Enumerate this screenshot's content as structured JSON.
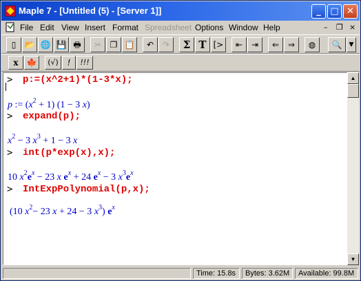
{
  "window": {
    "title": "Maple 7  - [Untitled (5) - [Server 1]]",
    "controls": {
      "minimize": "_",
      "maximize": "□",
      "close": "✕"
    }
  },
  "menu": {
    "items": [
      "File",
      "Edit",
      "View",
      "Insert",
      "Format",
      "Spreadsheet",
      "Options",
      "Window",
      "Help"
    ],
    "disabled": [
      "Spreadsheet"
    ],
    "doc_controls": {
      "minimize": "–",
      "restore": "❐",
      "close": "×"
    }
  },
  "toolbar1": {
    "buttons": [
      {
        "name": "new-icon",
        "glyph": "▯"
      },
      {
        "name": "open-icon",
        "glyph": "📂"
      },
      {
        "name": "open-url-icon",
        "glyph": "🌐"
      },
      {
        "name": "save-icon",
        "glyph": "💾"
      },
      {
        "name": "print-icon",
        "glyph": "🖶"
      },
      {
        "name": "cut-icon",
        "glyph": "✂"
      },
      {
        "name": "copy-icon",
        "glyph": "❐"
      },
      {
        "name": "paste-icon",
        "glyph": "📋"
      },
      {
        "name": "undo-icon",
        "glyph": "↶"
      },
      {
        "name": "redo-icon",
        "glyph": "↷"
      },
      {
        "name": "sigma-icon",
        "glyph": "Σ"
      },
      {
        "name": "text-icon",
        "glyph": "T"
      },
      {
        "name": "input-icon",
        "glyph": "[>"
      },
      {
        "name": "unindent-icon",
        "glyph": "⇤"
      },
      {
        "name": "indent-icon",
        "glyph": "⇥"
      },
      {
        "name": "back-icon",
        "glyph": "⇐"
      },
      {
        "name": "forward-icon",
        "glyph": "⇒"
      },
      {
        "name": "stop-icon",
        "glyph": "◍"
      },
      {
        "name": "zoom-icon",
        "glyph": "🔍"
      }
    ]
  },
  "toolbar2": {
    "buttons": [
      {
        "name": "math-mode-icon",
        "glyph": "x"
      },
      {
        "name": "maple-leaf-icon",
        "glyph": "🍁"
      },
      {
        "name": "check-syntax-icon",
        "glyph": "(√)"
      },
      {
        "name": "execute-icon",
        "glyph": "!"
      },
      {
        "name": "execute-all-icon",
        "glyph": "!!!"
      }
    ]
  },
  "worksheet": {
    "prompt": ">",
    "commands": [
      "p:=(x^2+1)*(1-3*x);",
      "expand(p);",
      "int(p*exp(x),x);",
      "IntExpPolynomial(p,x);"
    ],
    "outputs": {
      "out1": [
        "p",
        " := (",
        "x",
        "2",
        " + 1) (1 − 3 ",
        "x",
        ")"
      ],
      "out2": [
        "x",
        "2",
        " − 3 ",
        "x",
        "3",
        " + 1 − 3 ",
        "x"
      ],
      "out3": [
        "10 ",
        "x",
        "2",
        "e",
        "x",
        " − 23 ",
        "x",
        "e",
        "x",
        " + 24 ",
        "e",
        "x",
        " − 3 ",
        "x",
        "3",
        "e",
        "x"
      ],
      "out4": [
        "(10 ",
        "x",
        "2",
        "− 23 ",
        "x",
        " + 24  − 3 ",
        "x",
        "3",
        ") ",
        "e",
        "x"
      ]
    }
  },
  "status": {
    "time": "Time:  15.8s",
    "bytes": "Bytes: 3.62M",
    "available": "Available: 99.8M"
  }
}
